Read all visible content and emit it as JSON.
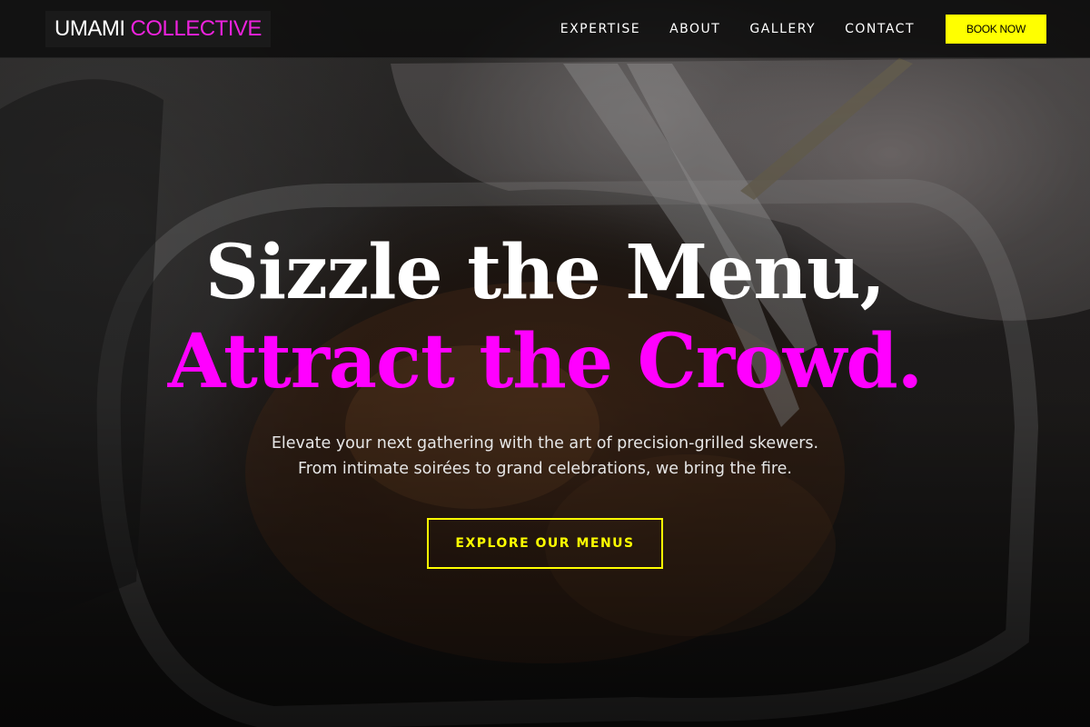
{
  "header": {
    "logo_word1": "UMAMI",
    "logo_word2": "COLLECTIVE",
    "nav": [
      {
        "label": "EXPERTISE"
      },
      {
        "label": "ABOUT"
      },
      {
        "label": "GALLERY"
      },
      {
        "label": "CONTACT"
      }
    ],
    "cta_label": "BOOK NOW"
  },
  "hero": {
    "headline_line1": "Sizzle the Menu,",
    "headline_line2": "Attract the Crowd.",
    "subtext_line1": "Elevate your next gathering with the art of precision-grilled skewers.",
    "subtext_line2": "From intimate soirées to grand celebrations, we bring the fire.",
    "button_label": "EXPLORE OUR MENUS"
  },
  "colors": {
    "accent_magenta": "#ff00ff",
    "accent_yellow": "#ffff00",
    "nav_background": "#0a0a0a"
  }
}
